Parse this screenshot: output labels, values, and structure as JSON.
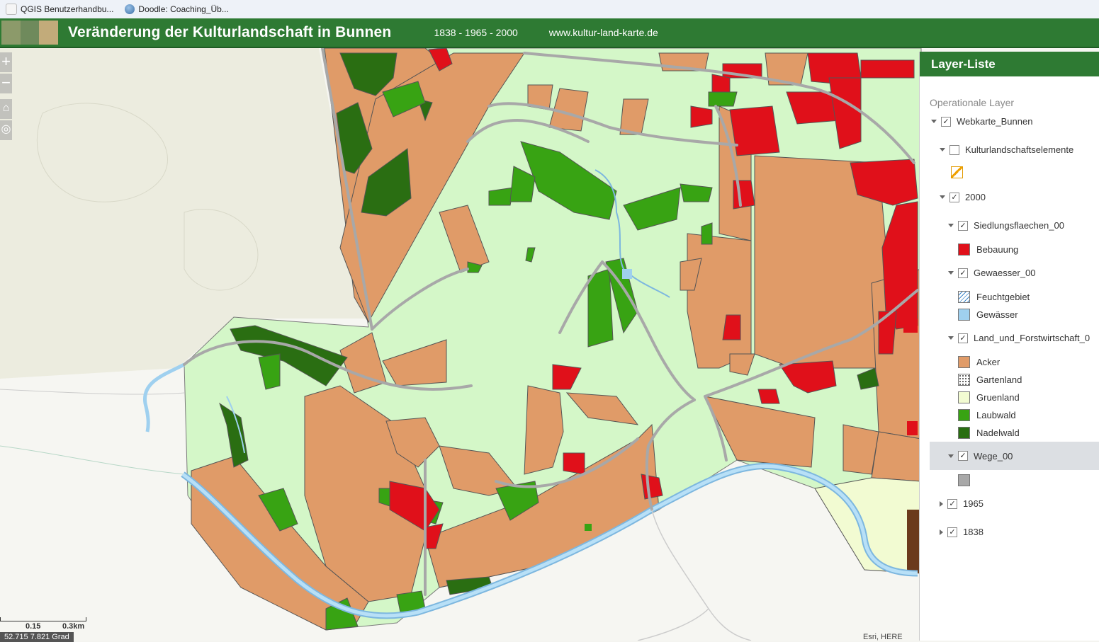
{
  "bookmarks": [
    {
      "label": "QGIS Benutzerhandbu..."
    },
    {
      "label": "Doodle: Coaching_Üb..."
    }
  ],
  "header": {
    "title": "Veränderung der Kulturlandschaft in Bunnen",
    "years": "1838 - 1965 - 2000",
    "site": "www.kultur-land-karte.de"
  },
  "controls": {
    "zoom_in": "+",
    "zoom_out": "−"
  },
  "scalebar": {
    "mid": "0.15",
    "end": "0.3km"
  },
  "coords": "52.715 7.821 Grad",
  "attribution": "Esri, HERE",
  "layer_panel": {
    "title": "Layer-Liste",
    "section": "Operationale Layer",
    "webkarte": "Webkarte_Bunnen",
    "kultur": "Kulturlandschaftselemente",
    "y2000": "2000",
    "siedlung": "Siedlungsflaechen_00",
    "bebauung": "Bebauung",
    "gewaesser": "Gewaesser_00",
    "feucht": "Feuchtgebiet",
    "gewaesser_item": "Gewässer",
    "land": "Land_und_Forstwirtschaft_0",
    "acker": "Acker",
    "garten": "Gartenland",
    "gruen": "Gruenland",
    "laub": "Laubwald",
    "nadel": "Nadelwald",
    "wege": "Wege_00",
    "y1965": "1965",
    "y1838": "1838"
  },
  "colors": {
    "header_green": "#2e7a33",
    "acker": "#e09b68",
    "gruenland": "#d4f7c8",
    "gartenland_pale": "#f2fbd2",
    "laubwald": "#38a313",
    "nadelwald": "#2a6e12",
    "bebauung": "#e0101a",
    "gewaesser": "#9fd0ef",
    "wege": "#a8a8a8"
  }
}
